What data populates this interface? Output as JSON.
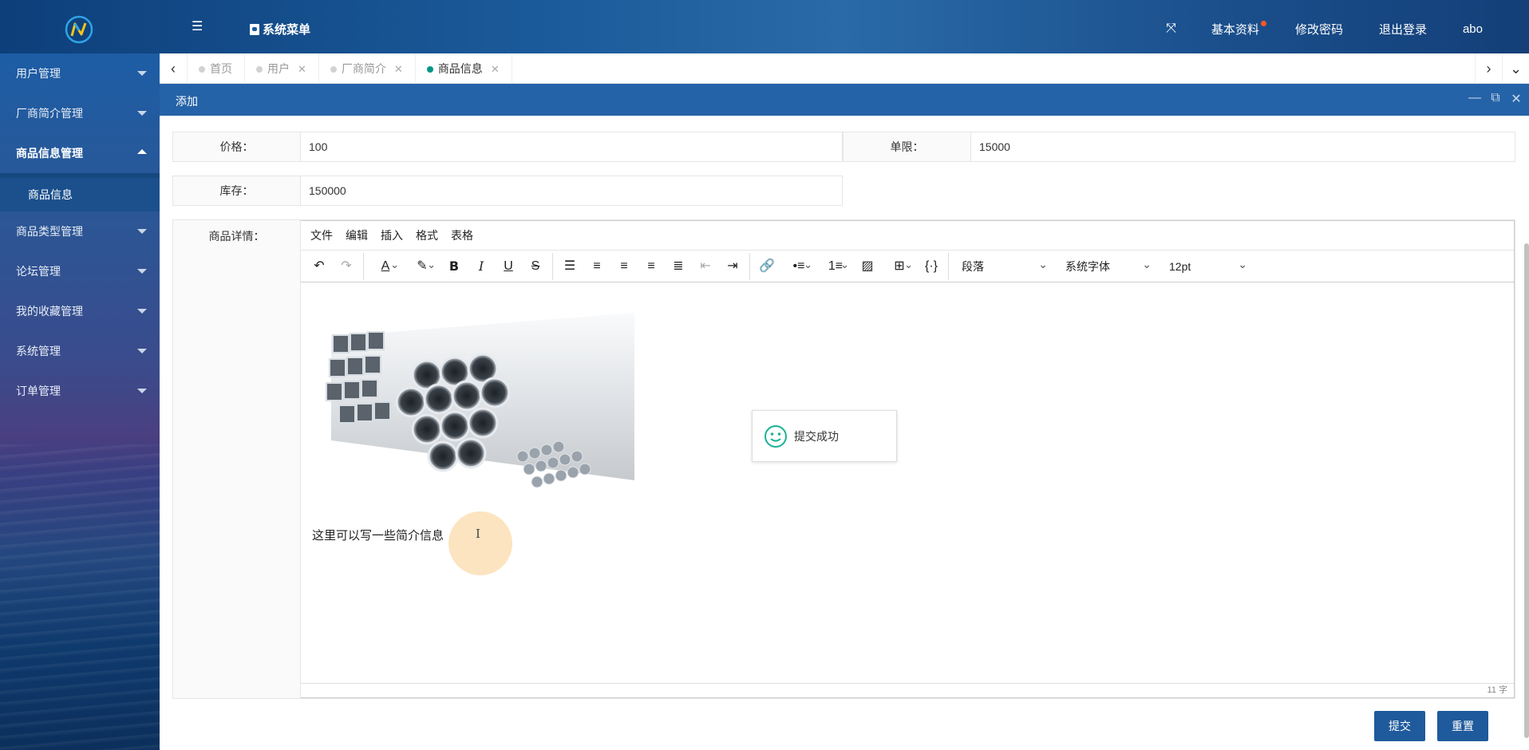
{
  "header": {
    "menu_title": "系统菜单",
    "right_items": [
      "基本资料",
      "修改密码",
      "退出登录"
    ],
    "username": "abo"
  },
  "sidebar": {
    "items": [
      {
        "label": "用户管理"
      },
      {
        "label": "厂商简介管理"
      },
      {
        "label": "商品信息管理"
      },
      {
        "label": "商品类型管理"
      },
      {
        "label": "论坛管理"
      },
      {
        "label": "我的收藏管理"
      },
      {
        "label": "系统管理"
      },
      {
        "label": "订单管理"
      }
    ],
    "sub_item": "商品信息"
  },
  "tabs": [
    {
      "label": "首页"
    },
    {
      "label": "用户"
    },
    {
      "label": "厂商简介"
    },
    {
      "label": "商品信息"
    }
  ],
  "dialog": {
    "title": "添加"
  },
  "form": {
    "price_label": "价格：",
    "price_value": "100",
    "limit_label": "单限：",
    "limit_value": "15000",
    "stock_label": "库存：",
    "stock_value": "150000",
    "detail_label": "商品详情："
  },
  "editor": {
    "menus": [
      "文件",
      "编辑",
      "插入",
      "格式",
      "表格"
    ],
    "paragraph": "段落",
    "font": "系统字体",
    "size": "12pt",
    "content_text": "这里可以写一些简介信息",
    "word_count": "11 字"
  },
  "toast": {
    "message": "提交成功"
  },
  "buttons": {
    "submit": "提交",
    "reset": "重置"
  },
  "colors": {
    "primary": "#2563a8",
    "button": "#1e5a9c",
    "active_tab_dot": "#009688",
    "notify_dot": "#ff5722"
  }
}
